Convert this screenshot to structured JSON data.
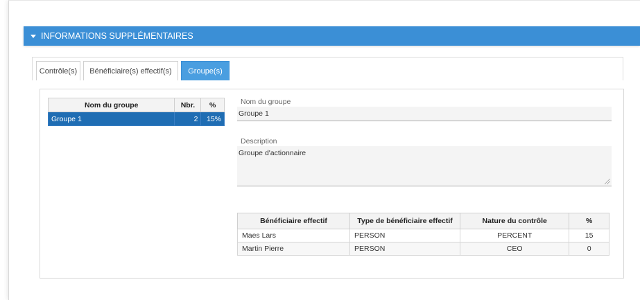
{
  "section": {
    "title": "INFORMATIONS SUPPLÉMENTAIRES"
  },
  "tabs": [
    {
      "label": "Contrôle(s)",
      "active": false
    },
    {
      "label": "Bénéficiaire(s) effectif(s)",
      "active": false
    },
    {
      "label": "Groupe(s)",
      "active": true
    }
  ],
  "groups_table": {
    "headers": [
      "Nom du groupe",
      "Nbr.",
      "%"
    ],
    "rows": [
      {
        "name": "Groupe 1",
        "count": "2",
        "percent": "15%",
        "selected": true
      }
    ]
  },
  "form": {
    "group_name_label": "Nom du groupe",
    "group_name_value": "Groupe 1",
    "description_label": "Description",
    "description_value": "Groupe d'actionnaire"
  },
  "beneficiaries_table": {
    "headers": [
      "Bénéficiaire effectif",
      "Type de bénéficiaire effectif",
      "Nature du contrôle",
      "%"
    ],
    "rows": [
      {
        "name": "Maes Lars",
        "type": "PERSON",
        "nature": "PERCENT",
        "percent": "15"
      },
      {
        "name": "Martin Pierre",
        "type": "PERSON",
        "nature": "CEO",
        "percent": "0"
      }
    ]
  },
  "colors": {
    "header_blue": "#3b8fd6",
    "selected_row": "#1f6db3",
    "active_tab": "#4a9ee0"
  }
}
